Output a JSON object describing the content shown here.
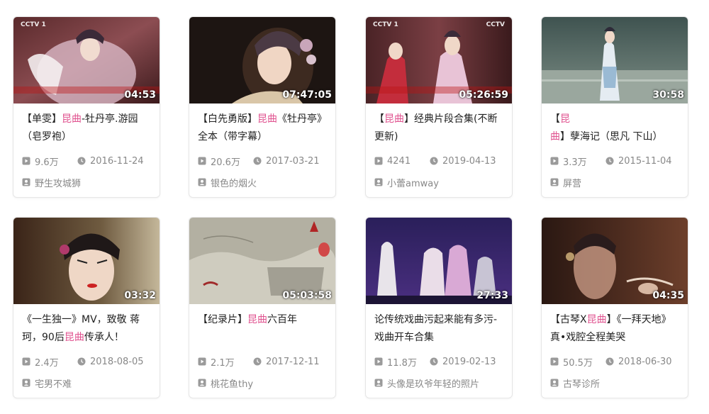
{
  "cards": [
    {
      "title_parts": [
        "【单雯】",
        "昆曲",
        "-牡丹亭.游园（皂罗袍）"
      ],
      "duration": "04:53",
      "views": "9.6万",
      "date": "2016-11-24",
      "author": "野生攻城狮",
      "logo_left": "CCTV 1",
      "logo_right": ""
    },
    {
      "title_parts": [
        "【白先勇版】",
        "昆曲",
        "《牡丹亭》全本（带字幕）"
      ],
      "duration": "07:47:05",
      "views": "20.6万",
      "date": "2017-03-21",
      "author": "银色的烟火",
      "logo_left": "",
      "logo_right": ""
    },
    {
      "title_parts": [
        "【",
        "昆曲",
        "】经典片段合集(不断更新)"
      ],
      "duration": "05:26:59",
      "views": "4241",
      "date": "2019-04-13",
      "author": "小蕾amway",
      "logo_left": "CCTV 1",
      "logo_right": "CCTV"
    },
    {
      "title_parts": [
        "【",
        "昆曲",
        "】孽海记（思凡 下山）"
      ],
      "duration": "30:58",
      "views": "3.3万",
      "date": "2015-11-04",
      "author": "屏营",
      "logo_left": "",
      "logo_right": ""
    },
    {
      "title_parts": [
        "《一生独一》MV，致敬 蒋珂，90后",
        "昆曲",
        "传承人！"
      ],
      "duration": "03:32",
      "views": "2.4万",
      "date": "2018-08-05",
      "author": "宅男不难",
      "logo_left": "",
      "logo_right": ""
    },
    {
      "title_parts": [
        "【纪录片】",
        "昆曲",
        "六百年"
      ],
      "duration": "05:03:58",
      "views": "2.1万",
      "date": "2017-12-11",
      "author": "桃花鱼thy",
      "logo_left": "",
      "logo_right": ""
    },
    {
      "title_parts": [
        "论传统戏曲污起来能有多污-戏曲开车合集",
        "",
        ""
      ],
      "duration": "27:33",
      "views": "11.8万",
      "date": "2019-02-13",
      "author": "头像是玖爷年轻的照片",
      "logo_left": "",
      "logo_right": ""
    },
    {
      "title_parts": [
        "【古琴X",
        "昆曲",
        "】《一拜天地》 真•戏腔全程美哭"
      ],
      "duration": "04:35",
      "views": "50.5万",
      "date": "2018-06-30",
      "author": "古琴诊所",
      "logo_left": "",
      "logo_right": ""
    }
  ],
  "colors": {
    "highlight": "#e0528f",
    "meta_text": "#888888",
    "title_text": "#222222"
  },
  "icons": {
    "views": "play-icon",
    "date": "clock-icon",
    "author": "user-icon"
  }
}
